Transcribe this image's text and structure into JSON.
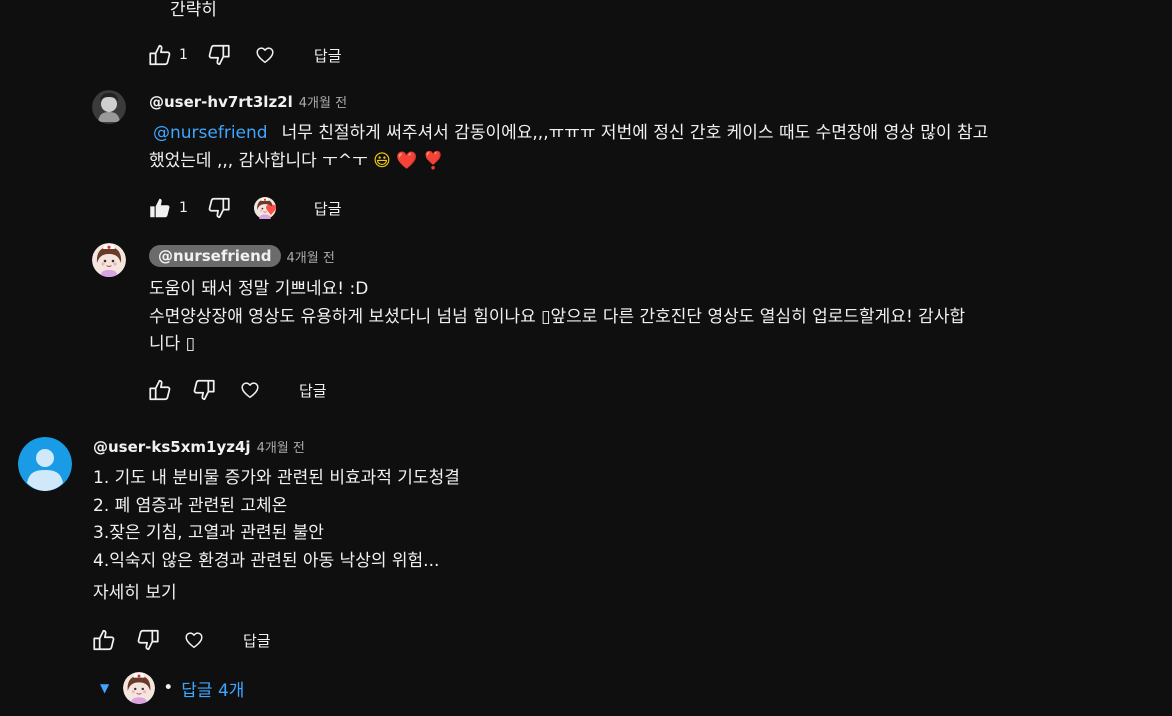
{
  "top": {
    "truncated_text": "간략히"
  },
  "thread1_actions": {
    "like_count": "1",
    "reply_label": "답글"
  },
  "reply1": {
    "author": "@user-hv7rt3lz2l",
    "time": "4개월 전",
    "mention": "@nursefriend",
    "line1": "너무 친절하게 써주셔서 감동이에요,,,ㅠㅠㅠ 저번에 정신 간호 케이스 때도 수면장애 영상 많이 참고",
    "line2_text": "했었는데 ,,, 감사합니다 ㅜ^ㅜ ",
    "emoji1": "😃",
    "emoji2": "❤️",
    "emoji3": "❣️",
    "like_count": "1",
    "reply_label": "답글"
  },
  "reply2": {
    "author": "@nursefriend",
    "time": "4개월 전",
    "line1": "도움이 돼서 정말 기쁘네요! :D",
    "line2": "수면양상장애 영상도 유용하게 보셨다니 넘넘 힘이나요 ▯앞으로 다른 간호진단 영상도 열심히 업로드할게요! 감사합",
    "line3": "니다 ▯",
    "reply_label": "답글"
  },
  "comment2": {
    "author": "@user-ks5xm1yz4j",
    "time": "4개월 전",
    "lines": [
      "1. 기도 내 분비물 증가와 관련된 비효과적 기도청결",
      "2. 폐 염증과 관련된 고체온",
      "3.잦은 기침, 고열과 관련된 불안",
      "4.익숙지 않은 환경과 관련된 아동 낙상의 위험..."
    ],
    "read_more": "자세히 보기",
    "reply_label": "답글",
    "replies_bullet": "•",
    "replies_text": "답글 4개"
  },
  "colors": {
    "background": "#0f0f0f",
    "link": "#3ea6ff",
    "muted": "#aaaaaa",
    "avatar_blue": "#1a9be6"
  }
}
